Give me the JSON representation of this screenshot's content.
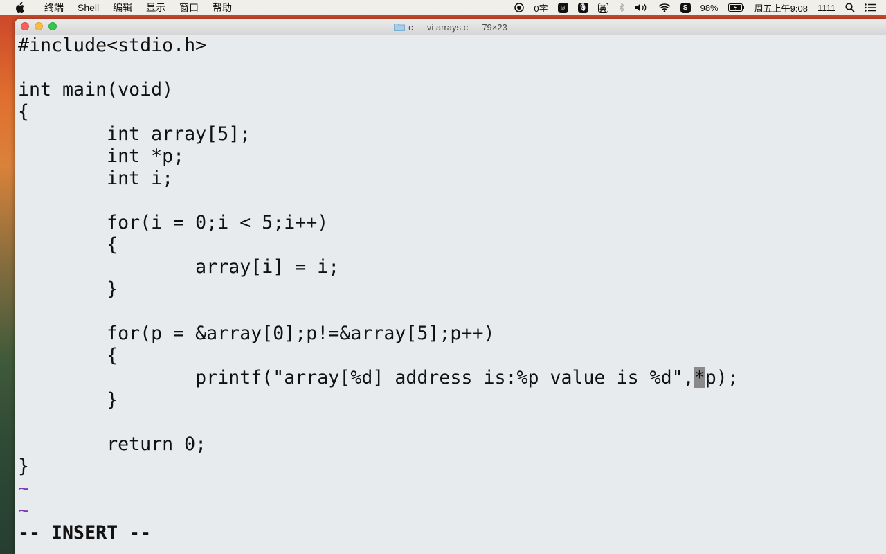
{
  "menubar": {
    "apple_icon": "apple-logo-icon",
    "items": [
      "终端",
      "Shell",
      "编辑",
      "显示",
      "窗口",
      "帮助"
    ],
    "status": {
      "record_icon": "record-icon",
      "char_count": "0字",
      "emoji_icon": "emoji-icon",
      "mic_icon": "microphone-icon",
      "input_method": "英",
      "bluetooth_icon": "bluetooth-icon",
      "volume_icon": "volume-icon",
      "wifi_icon": "wifi-icon",
      "sogou_icon": "sogou-s-icon",
      "battery": "98%",
      "battery_icon": "battery-charging-icon",
      "datetime": "周五上午9:08",
      "user": "1111",
      "search_icon": "spotlight-search-icon",
      "list_icon": "notification-list-icon"
    }
  },
  "window": {
    "title": "c — vi arrays.c — 79×23"
  },
  "editor": {
    "lines": [
      "#include<stdio.h>",
      "",
      "int main(void)",
      "{",
      "        int array[5];",
      "        int *p;",
      "        int i;",
      "",
      "        for(i = 0;i < 5;i++)",
      "        {",
      "                array[i] = i;",
      "        }",
      "",
      "        for(p = &array[0];p!=&array[5];p++)",
      "        {",
      "                printf(\"array[%d] address is:%p value is %d\",",
      "        }",
      "",
      "        return 0;",
      "}"
    ],
    "cursor_char": "*",
    "after_cursor": "p);",
    "tildes": [
      "~",
      "~"
    ],
    "mode": "-- INSERT --"
  },
  "colors": {
    "terminal_bg": "#e8ebee",
    "tilde": "#7a3bb0",
    "cursor": "#8a8a8a"
  }
}
